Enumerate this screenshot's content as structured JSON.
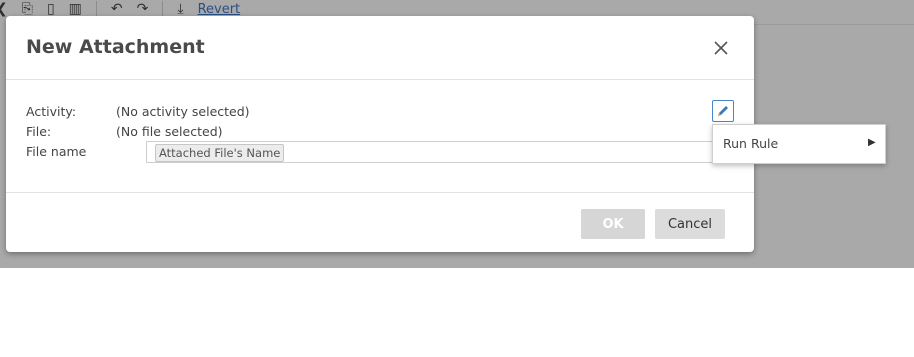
{
  "toolbar": {
    "revert_label": "Revert",
    "icons": [
      "back-icon",
      "copy-icon",
      "paste-icon",
      "delete-icon",
      "undo-icon",
      "redo-icon",
      "download-icon"
    ]
  },
  "dialog": {
    "title": "New Attachment",
    "fields": {
      "activity_label": "Activity:",
      "activity_value": "(No activity selected)",
      "file_label": "File:",
      "file_value": "(No file selected)",
      "filename_label": "File name",
      "filename_token": "Attached File's Name"
    },
    "buttons": {
      "ok_label": "OK",
      "cancel_label": "Cancel"
    }
  },
  "context_menu": {
    "items": [
      {
        "label": "Run Rule",
        "has_submenu": true
      }
    ]
  },
  "colors": {
    "accent": "#4a86c5",
    "link": "#2a4f85",
    "backdrop": "#a9a9a9"
  }
}
